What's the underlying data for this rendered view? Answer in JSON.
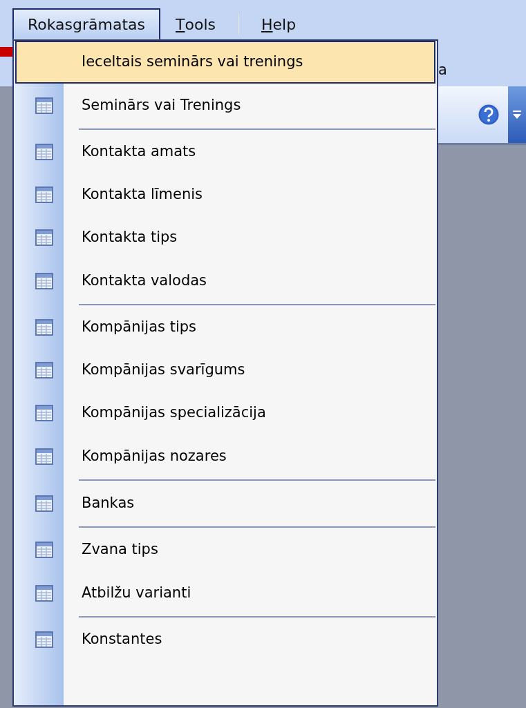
{
  "menubar": [
    {
      "label": "Rokasgrāmatas",
      "mnemonic": false,
      "selected": true
    },
    {
      "label": "Tools",
      "mnemonic": true,
      "selected": false
    },
    {
      "label": "Help",
      "mnemonic": true,
      "selected": false
    }
  ],
  "background_text": "a",
  "menu": [
    {
      "label": "Ieceltais seminārs vai trenings",
      "icon": false,
      "selected": true,
      "separator_after": false
    },
    {
      "label": "Seminārs vai Trenings",
      "icon": true,
      "selected": false,
      "separator_after": true
    },
    {
      "label": "Kontakta amats",
      "icon": true,
      "selected": false,
      "separator_after": false
    },
    {
      "label": "Kontakta līmenis",
      "icon": true,
      "selected": false,
      "separator_after": false
    },
    {
      "label": "Kontakta tips",
      "icon": true,
      "selected": false,
      "separator_after": false
    },
    {
      "label": "Kontakta valodas",
      "icon": true,
      "selected": false,
      "separator_after": true
    },
    {
      "label": "Kompānijas tips",
      "icon": true,
      "selected": false,
      "separator_after": false
    },
    {
      "label": "Kompānijas svarīgums",
      "icon": true,
      "selected": false,
      "separator_after": false
    },
    {
      "label": "Kompānijas specializācija",
      "icon": true,
      "selected": false,
      "separator_after": false
    },
    {
      "label": "Kompānijas nozares",
      "icon": true,
      "selected": false,
      "separator_after": true
    },
    {
      "label": "Bankas",
      "icon": true,
      "selected": false,
      "separator_after": true
    },
    {
      "label": "Zvana tips",
      "icon": true,
      "selected": false,
      "separator_after": false
    },
    {
      "label": "Atbilžu varianti",
      "icon": true,
      "selected": false,
      "separator_after": true
    },
    {
      "label": "Konstantes",
      "icon": true,
      "selected": false,
      "separator_after": false
    }
  ]
}
